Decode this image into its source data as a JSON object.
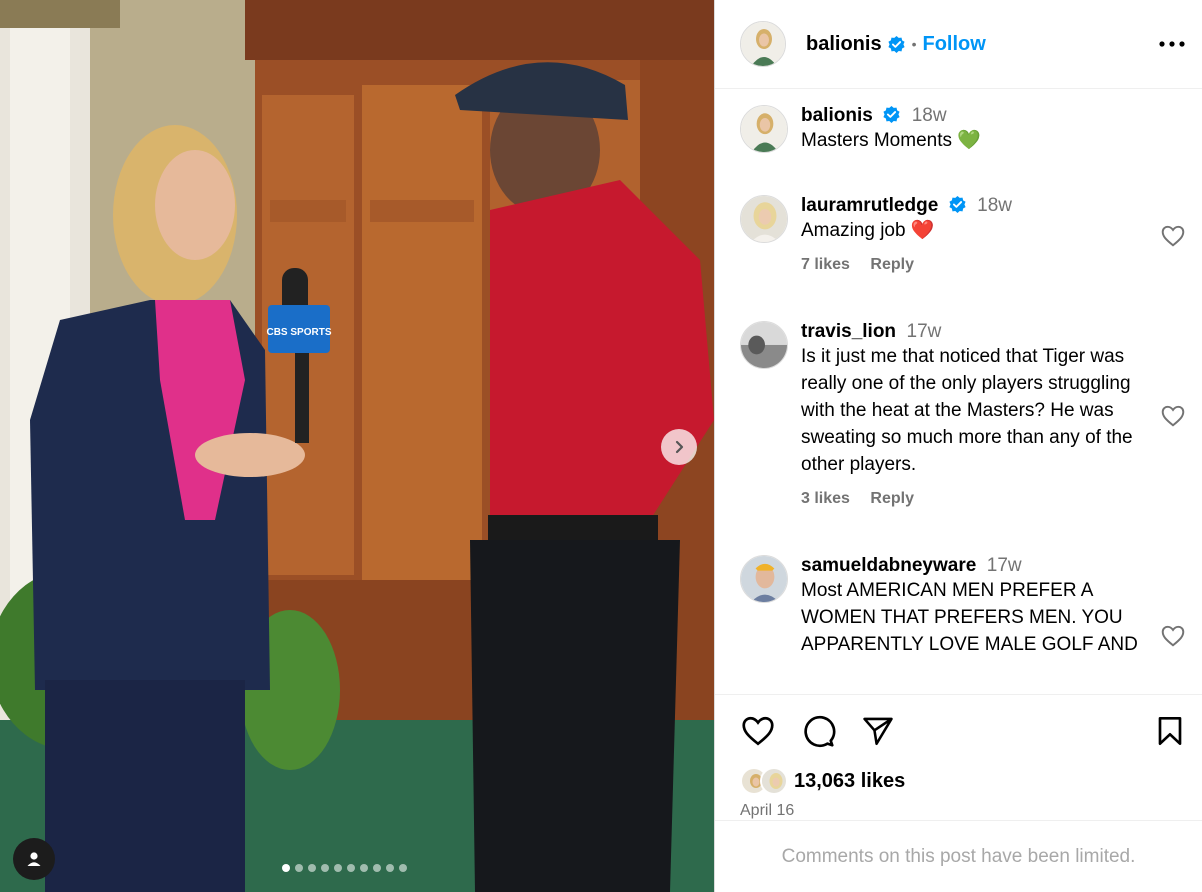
{
  "media": {
    "image_alt": "Reporter interviewing golfer in a wood-paneled locker room",
    "mic_flag_text": "CBS SPORTS",
    "slide_count": 10,
    "active_slide": 1
  },
  "header": {
    "username": "balionis",
    "separator": "•",
    "follow_label": "Follow"
  },
  "caption": {
    "username": "balionis",
    "time": "18w",
    "text": "Masters Moments",
    "emoji": "💚"
  },
  "comments": [
    {
      "username": "lauramrutledge",
      "verified": true,
      "time": "18w",
      "text": "Amazing job ❤️",
      "likes": "7 likes",
      "reply": "Reply"
    },
    {
      "username": "travis_lion",
      "verified": false,
      "time": "17w",
      "text": "Is it just me that noticed that Tiger was really one of the only players struggling with the heat at the Masters? He was sweating so much more than any of the other players.",
      "likes": "3 likes",
      "reply": "Reply"
    },
    {
      "username": "samueldabneyware",
      "verified": false,
      "time": "17w",
      "text": "Most AMERICAN MEN PREFER A WOMEN THAT PREFERS MEN. YOU APPARENTLY LOVE MALE GOLF AND"
    }
  ],
  "likes": {
    "count": "13,063 likes"
  },
  "post_date": "April 16",
  "comments_limited": "Comments on this post have been limited.",
  "colors": {
    "link_blue": "#0095f6",
    "verified_blue": "#0095f6",
    "muted": "#737373",
    "heart_red": "#e0242f",
    "heart_green": "#2ecc40"
  }
}
